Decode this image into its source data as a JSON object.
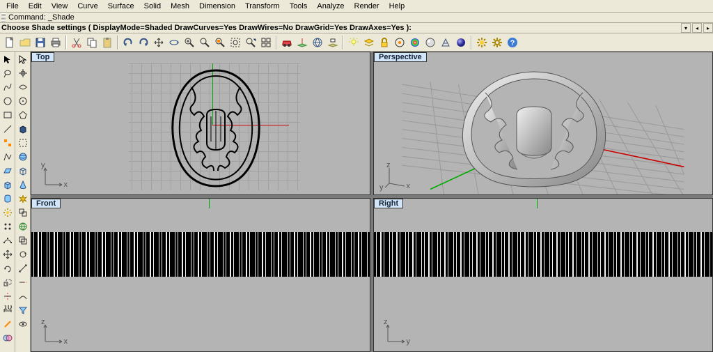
{
  "menu": {
    "items": [
      "File",
      "Edit",
      "View",
      "Curve",
      "Surface",
      "Solid",
      "Mesh",
      "Dimension",
      "Transform",
      "Tools",
      "Analyze",
      "Render",
      "Help"
    ]
  },
  "command_history": "Command: _Shade",
  "command_prompt": "Choose Shade settings ( DisplayMode=Shaded  DrawCurves=Yes  DrawWires=No  DrawGrid=Yes  DrawAxes=Yes ): ",
  "viewports": {
    "tl": {
      "title": "Top",
      "gizmo_x": "x",
      "gizmo_y": "y"
    },
    "tr": {
      "title": "Perspective",
      "gizmo_x": "x",
      "gizmo_y": "y",
      "gizmo_z": "z"
    },
    "bl": {
      "title": "Front",
      "gizmo_x": "x",
      "gizmo_y": "z"
    },
    "br": {
      "title": "Right",
      "gizmo_x": "y",
      "gizmo_y": "z"
    }
  },
  "toolbar_icons": [
    "new",
    "open",
    "save",
    "print",
    "cut",
    "copy",
    "paste",
    "undo",
    "redo",
    "pan",
    "rotate-view",
    "zoom-in",
    "zoom-extents",
    "zoom-selected",
    "zoom-window",
    "zoom-dynamic",
    "viewport-layout",
    "car",
    "set-cplane",
    "cplane-world",
    "cplane-named",
    "shade",
    "light",
    "layers",
    "lock",
    "object-properties",
    "materials",
    "render",
    "perspective",
    "sphere",
    "options",
    "gear2",
    "help"
  ],
  "left_tool_icons": [
    "arrow",
    "lasso",
    "freeform",
    "circle",
    "rectangle",
    "line",
    "seltools",
    "polyline",
    "plane",
    "box",
    "cylinder",
    "gear",
    "array",
    "edit-pt",
    "move",
    "rotate",
    "scale",
    "trim",
    "dimension",
    "edge",
    "boolean"
  ],
  "right_tool_icons": [
    "pointer",
    "crosshair",
    "curve",
    "circle2",
    "polygon",
    "solid",
    "select",
    "sphere2",
    "box2",
    "cone",
    "burst",
    "group",
    "globe",
    "copy2",
    "rotate2",
    "scale2",
    "extend",
    "bend",
    "filter",
    "show"
  ]
}
